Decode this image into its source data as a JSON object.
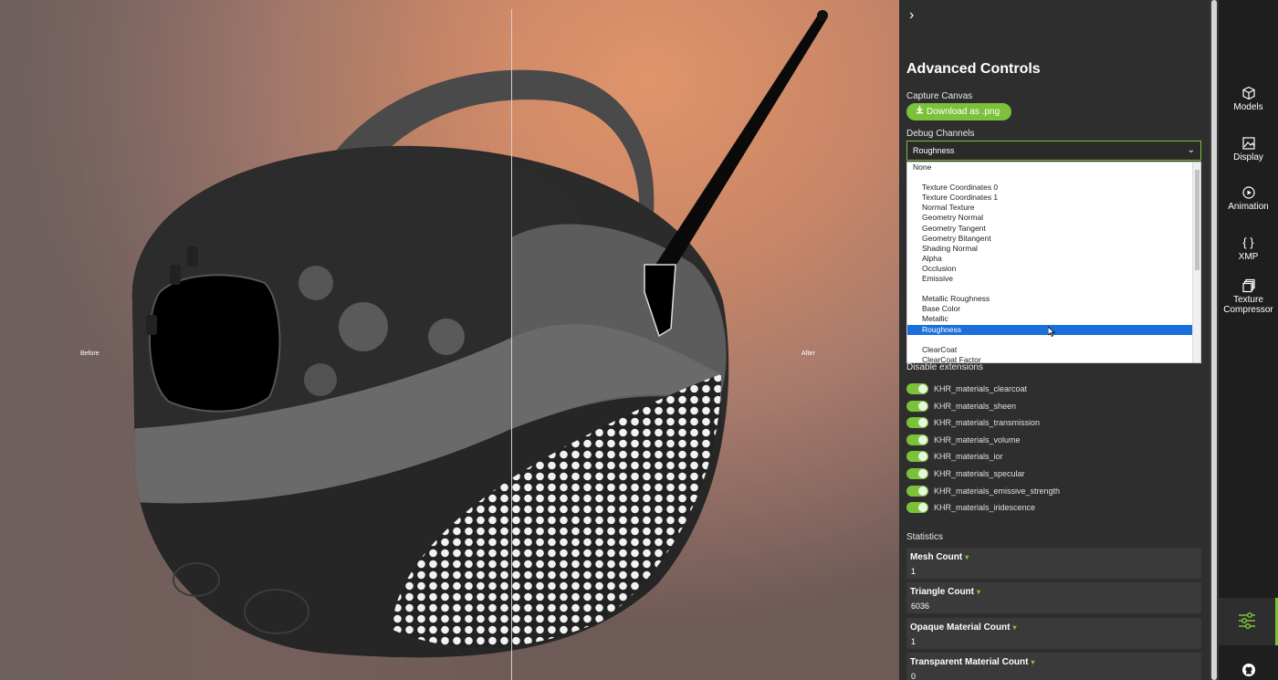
{
  "viewport": {
    "before_label": "Before",
    "after_label": "After"
  },
  "panel": {
    "title": "Advanced Controls",
    "capture_label": "Capture Canvas",
    "download_label": "Download as .png",
    "debug_label": "Debug Channels",
    "debug_selected": "Roughness",
    "debug_options": [
      {
        "label": "None",
        "group": true
      },
      {
        "label": "",
        "group": true
      },
      {
        "label": "Texture Coordinates 0"
      },
      {
        "label": "Texture Coordinates 1"
      },
      {
        "label": "Normal Texture"
      },
      {
        "label": "Geometry Normal"
      },
      {
        "label": "Geometry Tangent"
      },
      {
        "label": "Geometry Bitangent"
      },
      {
        "label": "Shading Normal"
      },
      {
        "label": "Alpha"
      },
      {
        "label": "Occlusion"
      },
      {
        "label": "Emissive"
      },
      {
        "label": "",
        "group": true
      },
      {
        "label": "Metallic Roughness"
      },
      {
        "label": "Base Color"
      },
      {
        "label": "Metallic"
      },
      {
        "label": "Roughness",
        "selected": true
      },
      {
        "label": "",
        "group": true
      },
      {
        "label": "ClearCoat"
      },
      {
        "label": "ClearCoat Factor"
      }
    ],
    "disable_ext_label": "Disable extensions",
    "extensions": [
      "KHR_materials_clearcoat",
      "KHR_materials_sheen",
      "KHR_materials_transmission",
      "KHR_materials_volume",
      "KHR_materials_ior",
      "KHR_materials_specular",
      "KHR_materials_emissive_strength",
      "KHR_materials_iridescence"
    ],
    "statistics_label": "Statistics",
    "stats": [
      {
        "label": "Mesh Count",
        "value": "1"
      },
      {
        "label": "Triangle Count",
        "value": "6036"
      },
      {
        "label": "Opaque Material Count",
        "value": "1"
      },
      {
        "label": "Transparent Material Count",
        "value": "0"
      }
    ]
  },
  "sidebar": {
    "items": [
      {
        "label": "Models",
        "icon": "cube-icon"
      },
      {
        "label": "Display",
        "icon": "image-icon"
      },
      {
        "label": "Animation",
        "icon": "play-circle-icon"
      },
      {
        "label": "XMP",
        "icon": "braces-icon"
      },
      {
        "label": "Texture Compressor",
        "icon": "layers-icon"
      }
    ]
  },
  "colors": {
    "accent": "#7cc13a",
    "selection": "#1a6fdc",
    "panel_bg": "#2e2e2e",
    "sidebar_bg": "#1e1e1e"
  }
}
